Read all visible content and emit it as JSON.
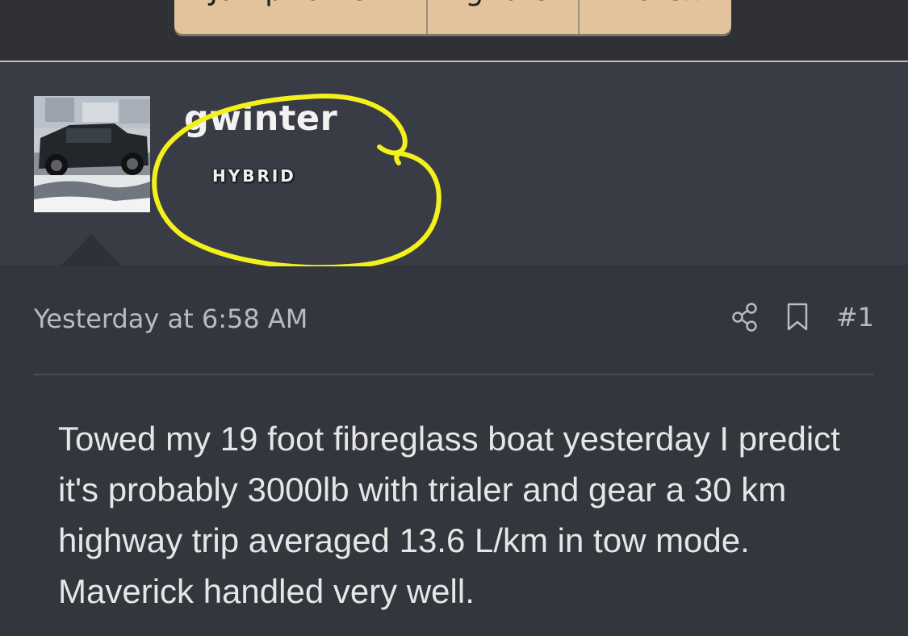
{
  "thread_buttons": {
    "jump": "Jump to new",
    "ignore": "Ignore",
    "watch": "Watch"
  },
  "post": {
    "username": "gwinter",
    "badge": "HYBRID",
    "timestamp": "Yesterday at 6:58 AM",
    "post_number": "#1",
    "message_lines": [
      "Towed my 19 foot fibreglass boat yesterday I predict it's probably 3000lb with trialer and gear a 30 km highway trip averaged 13.6 L/km in tow mode.",
      "Maverick handled very well."
    ]
  },
  "icons": {
    "share": "share-icon",
    "bookmark": "bookmark-icon"
  },
  "colors": {
    "button_bg": "#e3c39b",
    "page_bg": "#33363c",
    "annotation": "#f4f01c"
  }
}
